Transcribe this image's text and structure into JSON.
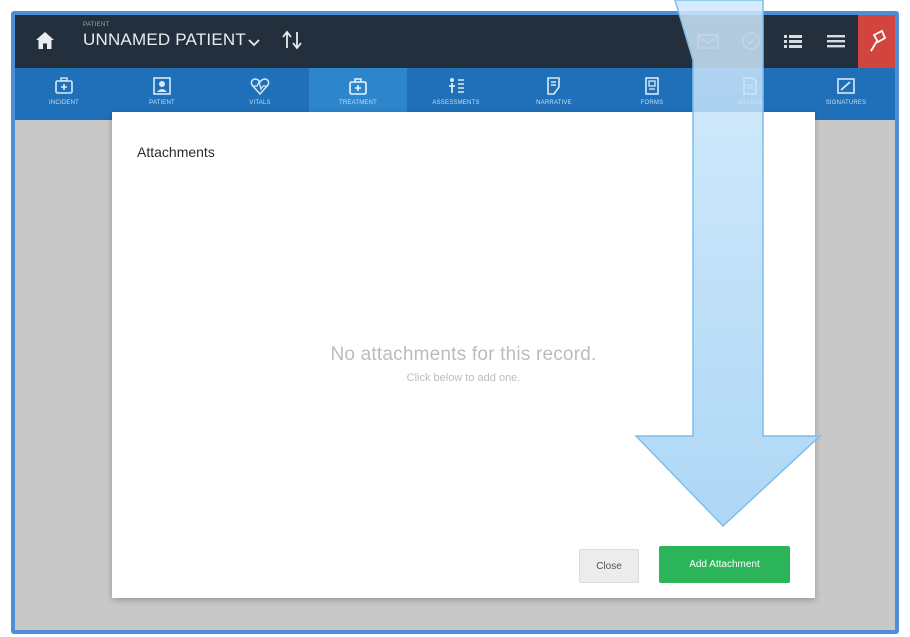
{
  "header": {
    "patient_caption": "PATIENT",
    "patient_name": "UNNAMED PATIENT"
  },
  "nav": {
    "items": [
      {
        "label": "INCIDENT",
        "icon": "incident-icon"
      },
      {
        "label": "PATIENT",
        "icon": "patient-icon"
      },
      {
        "label": "VITALS",
        "icon": "vitals-icon"
      },
      {
        "label": "TREATMENT",
        "icon": "treatment-icon"
      },
      {
        "label": "ASSESSMENTS",
        "icon": "assessments-icon"
      },
      {
        "label": "NARRATIVE",
        "icon": "narrative-icon"
      },
      {
        "label": "FORMS",
        "icon": "forms-icon"
      },
      {
        "label": "BILLING",
        "icon": "billing-icon"
      },
      {
        "label": "SIGNATURES",
        "icon": "signatures-icon"
      }
    ],
    "active_index": 3
  },
  "modal": {
    "title": "Attachments",
    "empty_title": "No attachments for this record.",
    "empty_subtitle": "Click below to add one.",
    "close_label": "Close",
    "add_label": "Add Attachment"
  },
  "colors": {
    "topbar": "#232f3c",
    "navbar": "#1f70b8",
    "alert": "#d2453e",
    "add_button": "#2bb45a",
    "frame_border": "#4d8ed6"
  }
}
